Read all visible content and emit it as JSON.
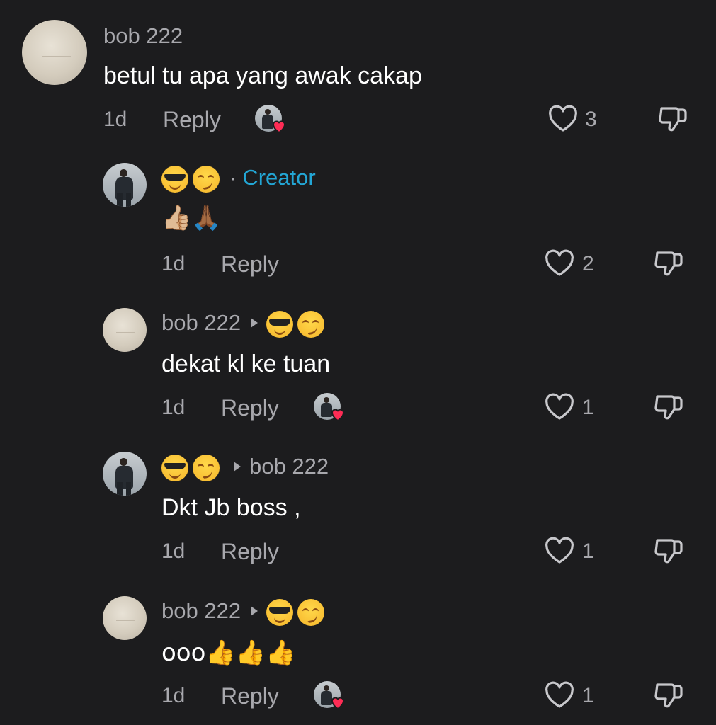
{
  "comments": [
    {
      "username": "bob 222",
      "text": "betul tu apa yang awak cakap",
      "time": "1d",
      "reply_label": "Reply",
      "likes": "3",
      "liked_by_creator": true
    },
    {
      "username_emoji": "😎😏",
      "creator_separator": "·",
      "creator_label": "Creator",
      "text": "👍🏼🙏🏾",
      "time": "1d",
      "reply_label": "Reply",
      "likes": "2",
      "liked_by_creator": false
    },
    {
      "username": "bob 222",
      "reply_to_emoji": "😎😏",
      "text": "dekat kl ke tuan",
      "time": "1d",
      "reply_label": "Reply",
      "likes": "1",
      "liked_by_creator": true
    },
    {
      "username_emoji": "😎😏",
      "reply_to": "bob 222",
      "text": "Dkt Jb boss ,",
      "time": "1d",
      "reply_label": "Reply",
      "likes": "1",
      "liked_by_creator": false
    },
    {
      "username": "bob 222",
      "reply_to_emoji": "😎😏",
      "text": "ooo👍👍👍",
      "time": "1d",
      "reply_label": "Reply",
      "likes": "1",
      "liked_by_creator": true
    }
  ],
  "colors": {
    "background": "#1c1c1e",
    "secondary_text": "#a8a8ad",
    "creator_accent": "#23a6d5",
    "heart_red": "#fe2c55"
  },
  "icons": [
    "heart-outline-icon",
    "dislike-icon",
    "liked-by-creator-heart-icon",
    "reply-arrow-icon"
  ]
}
